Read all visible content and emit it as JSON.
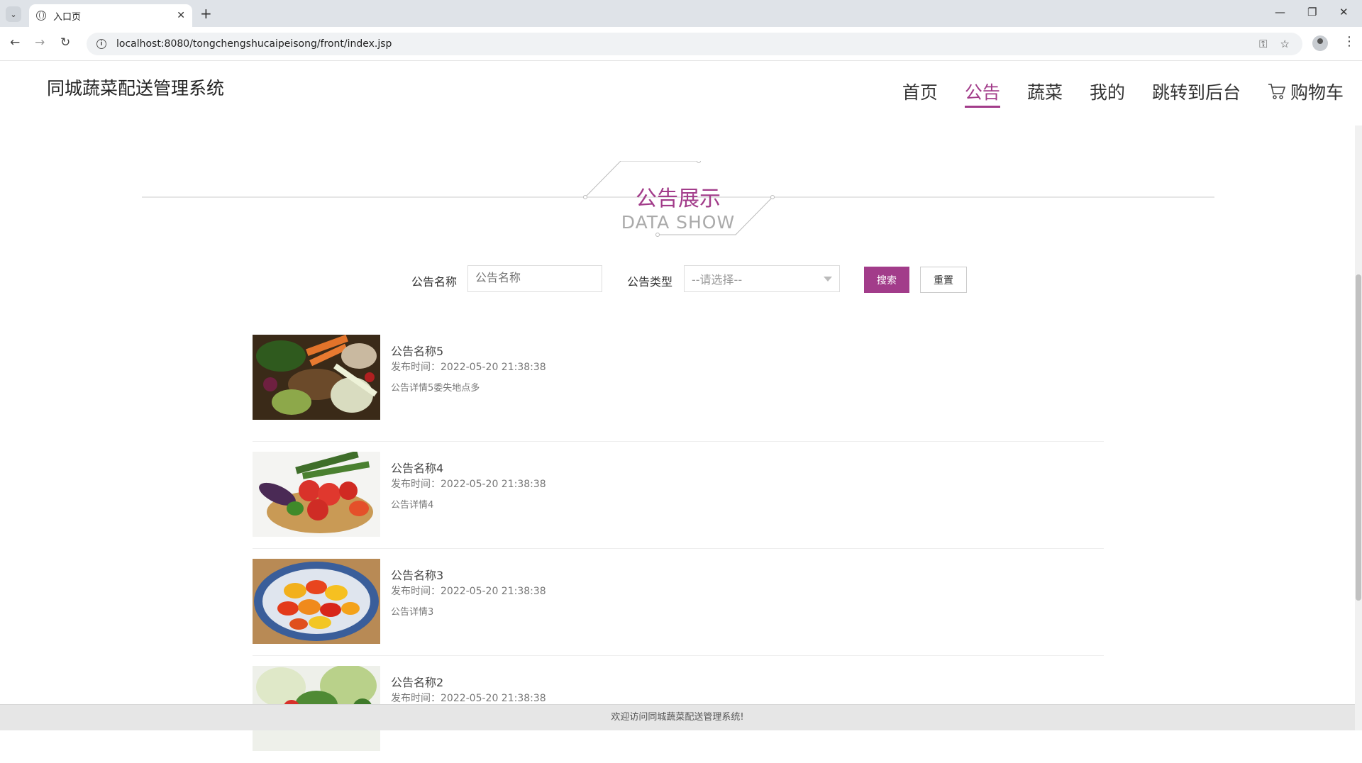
{
  "browser": {
    "tab_title": "入口页",
    "url": "localhost:8080/tongchengshucaipeisong/front/index.jsp"
  },
  "site": {
    "title": "同城蔬菜配送管理系统",
    "nav": [
      {
        "label": "首页",
        "active": false
      },
      {
        "label": "公告",
        "active": true
      },
      {
        "label": "蔬菜",
        "active": false
      },
      {
        "label": "我的",
        "active": false
      },
      {
        "label": "跳转到后台",
        "active": false
      },
      {
        "label": "购物车",
        "active": false
      }
    ]
  },
  "section": {
    "title": "公告展示",
    "subtitle": "DATA SHOW"
  },
  "search": {
    "name_label": "公告名称",
    "name_placeholder": "公告名称",
    "type_label": "公告类型",
    "type_selected": "--请选择--",
    "search_button": "搜索",
    "reset_button": "重置"
  },
  "notices": [
    {
      "title": "公告名称5",
      "time": "发布时间：2022-05-20 21:38:38",
      "detail": "公告详情5委失地点多"
    },
    {
      "title": "公告名称4",
      "time": "发布时间：2022-05-20 21:38:38",
      "detail": "公告详情4"
    },
    {
      "title": "公告名称3",
      "time": "发布时间：2022-05-20 21:38:38",
      "detail": "公告详情3"
    },
    {
      "title": "公告名称2",
      "time": "发布时间：2022-05-20 21:38:38",
      "detail": ""
    }
  ],
  "footer": {
    "text": "欢迎访问同城蔬菜配送管理系统!"
  },
  "colors": {
    "accent": "#a23c8a"
  }
}
